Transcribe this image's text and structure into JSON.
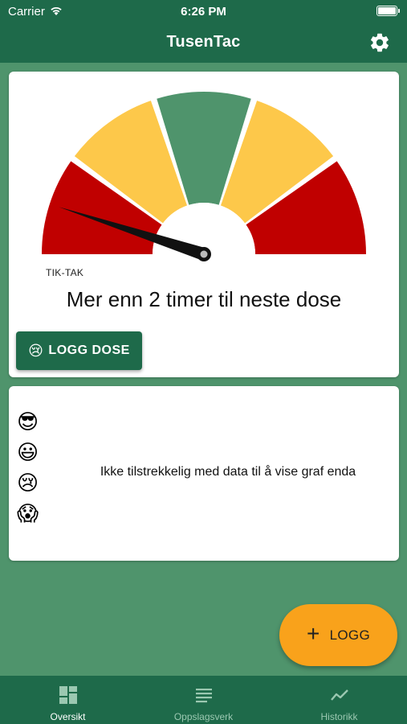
{
  "status_bar": {
    "carrier": "Carrier",
    "time": "6:26 PM"
  },
  "header": {
    "title": "TusenTac",
    "settings_icon": "gear-icon"
  },
  "gauge": {
    "label": "TIK-TAK",
    "message": "Mer enn 2 timer til neste dose",
    "needle_value": 0.1,
    "segments": [
      {
        "color": "#c00000"
      },
      {
        "color": "#fdc84a"
      },
      {
        "color": "#4f946c"
      },
      {
        "color": "#fdc84a"
      },
      {
        "color": "#c00000"
      }
    ]
  },
  "log_dose_button": {
    "emoji": "😢",
    "label": "LOGG DOSE"
  },
  "graph": {
    "mood_emojis": [
      "😎",
      "😃",
      "😢",
      "😱"
    ],
    "empty_message": "Ikke tilstrekkelig med data til å vise graf enda"
  },
  "fab": {
    "icon": "plus-icon",
    "label": "LOGG"
  },
  "tabs": [
    {
      "label": "Oversikt",
      "icon": "dashboard-icon",
      "active": true
    },
    {
      "label": "Oppslagsverk",
      "icon": "list-icon",
      "active": false
    },
    {
      "label": "Historikk",
      "icon": "trend-icon",
      "active": false
    }
  ],
  "colors": {
    "primary": "#1e6a4a",
    "background": "#4f946c",
    "accent": "#f9a21b",
    "red": "#c00000",
    "yellow": "#fdc84a"
  }
}
